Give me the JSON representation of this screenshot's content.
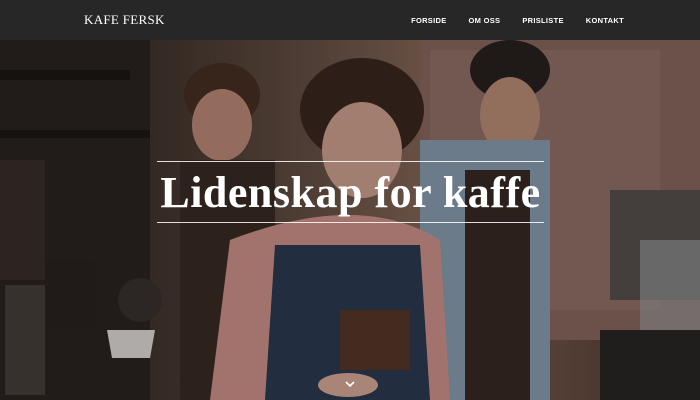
{
  "brand": "KAFE FERSK",
  "nav": {
    "items": [
      "FORSIDE",
      "OM OSS",
      "PRISLISTE",
      "KONTAKT"
    ]
  },
  "hero": {
    "title": "Lidenskap for kaffe",
    "scroll_icon": "chevron-down-icon"
  },
  "colors": {
    "navbar_bg": "#272727",
    "text": "#ffffff"
  }
}
